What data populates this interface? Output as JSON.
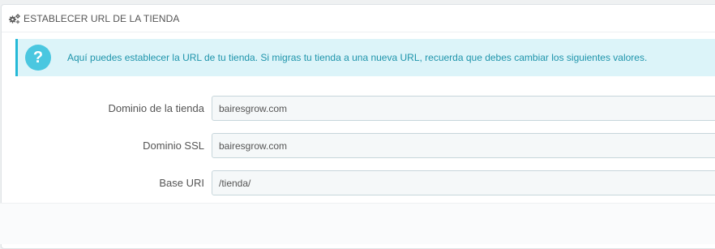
{
  "panel": {
    "title": "ESTABLECER URL DE LA TIENDA",
    "title_icon": "gears-icon"
  },
  "alert": {
    "icon": "question-icon",
    "icon_glyph": "?",
    "text": "Aquí puedes establecer la URL de tu tienda. Si migras tu tienda a una nueva URL, recuerda que debes cambiar los siguientes valores."
  },
  "form": {
    "domain": {
      "label": "Dominio de la tienda",
      "value": "bairesgrow.com"
    },
    "domain_ssl": {
      "label": "Dominio SSL",
      "value": "bairesgrow.com"
    },
    "base_uri": {
      "label": "Base URI",
      "value": "/tienda/"
    }
  },
  "colors": {
    "accent": "#25b9d7",
    "alert_bg": "#dcf4f9",
    "alert_text": "#1e94ab",
    "input_bg": "#f5f8f9",
    "input_border": "#c7d6db"
  }
}
